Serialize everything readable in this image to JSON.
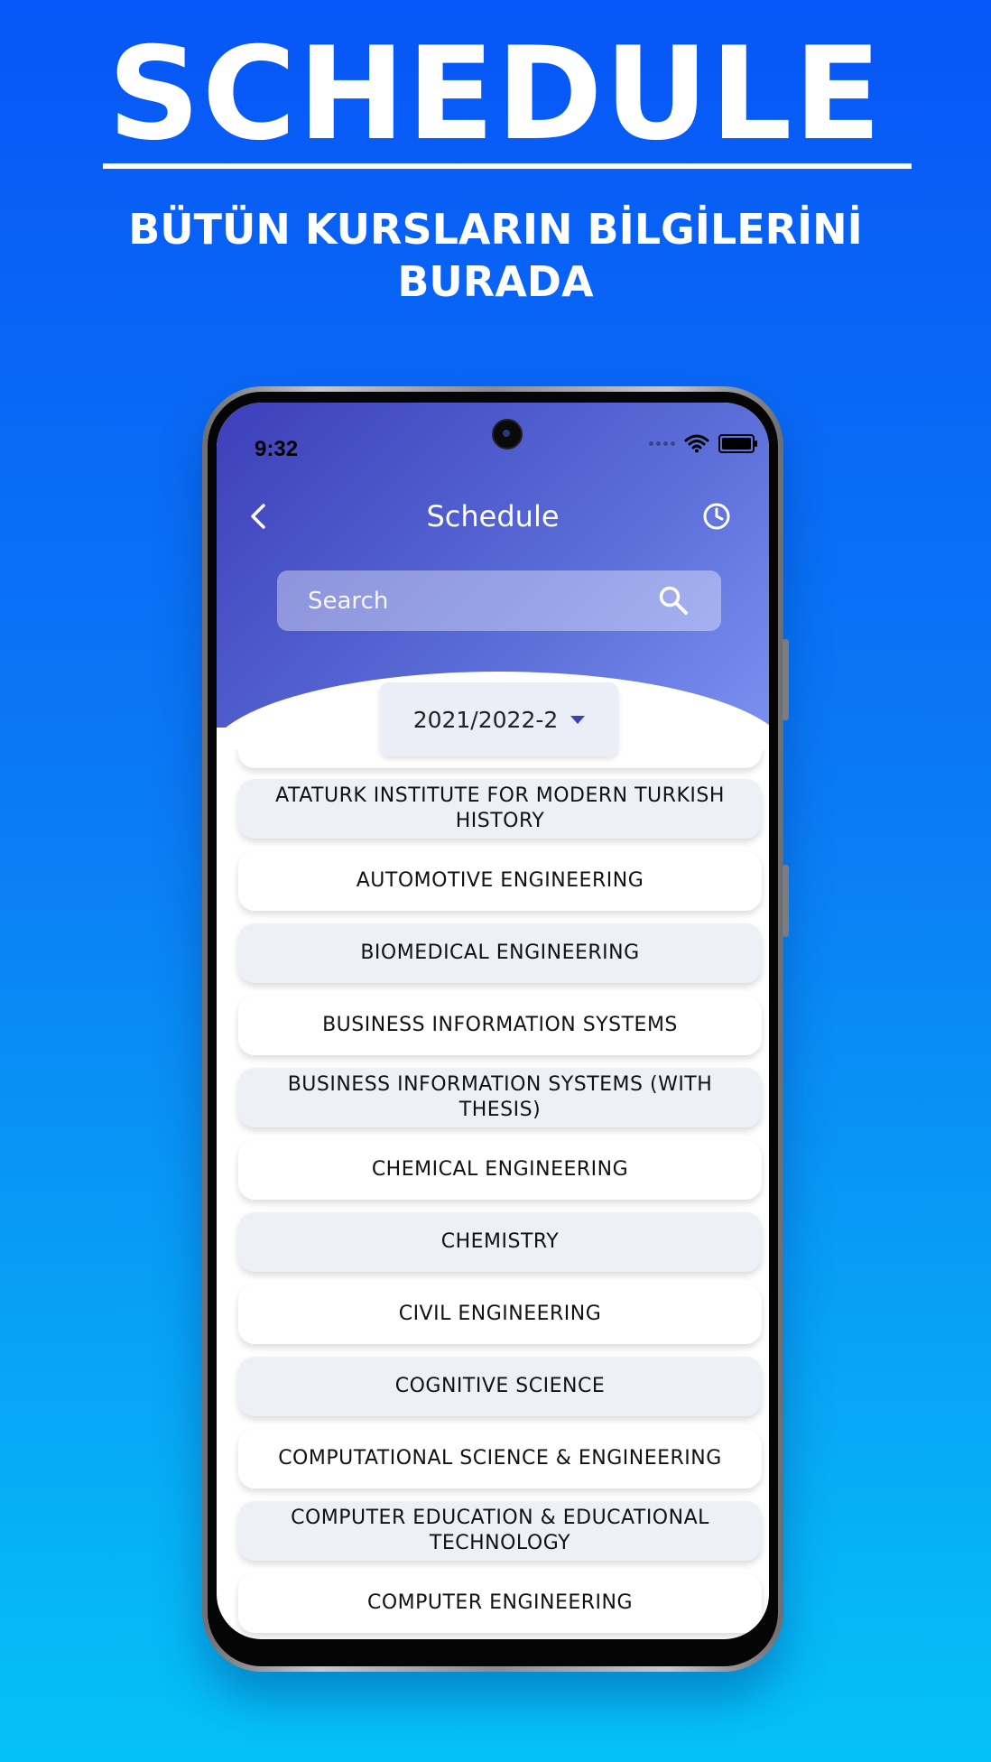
{
  "promo": {
    "title": "SCHEDULE",
    "subtitle_line1": "BÜTÜN KURSLARIN BİLGİLERİNİ",
    "subtitle_line2": "BURADA"
  },
  "status_bar": {
    "time": "9:32"
  },
  "header": {
    "title": "Schedule",
    "back_icon": "chevron-left-icon",
    "history_icon": "clock-icon"
  },
  "search": {
    "placeholder": "Search",
    "value": "",
    "icon": "search-icon"
  },
  "term_selector": {
    "value": "2021/2022-2",
    "icon": "caret-down-icon"
  },
  "courses": [
    "",
    "ATATURK INSTITUTE FOR MODERN TURKISH HISTORY",
    "AUTOMOTIVE ENGINEERING",
    "BIOMEDICAL ENGINEERING",
    "BUSINESS INFORMATION SYSTEMS",
    "BUSINESS INFORMATION SYSTEMS (WITH THESIS)",
    "CHEMICAL ENGINEERING",
    "CHEMISTRY",
    "CIVIL ENGINEERING",
    "COGNITIVE SCIENCE",
    "COMPUTATIONAL SCIENCE & ENGINEERING",
    "COMPUTER EDUCATION & EDUCATIONAL TECHNOLOGY",
    "COMPUTER ENGINEERING"
  ],
  "colors": {
    "background_top": "#0756f7",
    "background_bottom": "#05c2f6",
    "header_gradient_start": "#3d3fb9",
    "header_gradient_end": "#7b8ff0",
    "row_alt": "#eef0f8",
    "row_plain": "#ffffff"
  }
}
